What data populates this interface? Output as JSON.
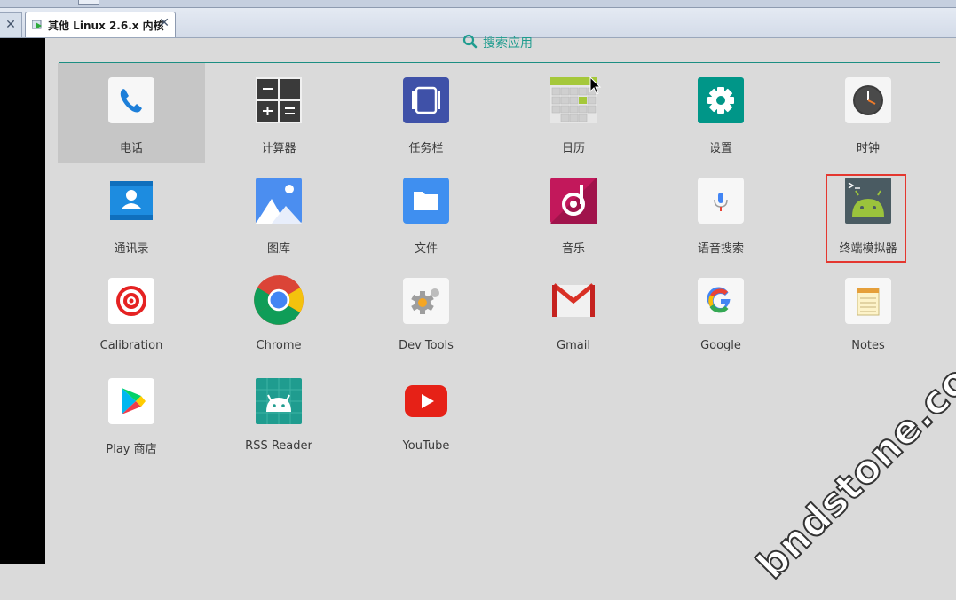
{
  "host": {
    "vm_tab_title": "其他 Linux 2.6.x 内核",
    "close_glyph": "✕"
  },
  "drawer": {
    "search_label": "搜索应用",
    "accent_color": "#1f9c8f",
    "apps": [
      {
        "label": "电话",
        "icon": "phone-icon"
      },
      {
        "label": "计算器",
        "icon": "calculator-icon"
      },
      {
        "label": "任务栏",
        "icon": "taskbar-icon"
      },
      {
        "label": "日历",
        "icon": "calendar-icon"
      },
      {
        "label": "设置",
        "icon": "gear-icon"
      },
      {
        "label": "时钟",
        "icon": "clock-icon"
      },
      {
        "label": "通讯录",
        "icon": "contacts-icon"
      },
      {
        "label": "图库",
        "icon": "gallery-icon"
      },
      {
        "label": "文件",
        "icon": "folder-icon"
      },
      {
        "label": "音乐",
        "icon": "music-icon"
      },
      {
        "label": "语音搜索",
        "icon": "microphone-icon"
      },
      {
        "label": "终端模拟器",
        "icon": "terminal-android-icon"
      },
      {
        "label": "Calibration",
        "icon": "target-icon"
      },
      {
        "label": "Chrome",
        "icon": "chrome-icon"
      },
      {
        "label": "Dev Tools",
        "icon": "dev-tools-gear-icon"
      },
      {
        "label": "Gmail",
        "icon": "gmail-icon"
      },
      {
        "label": "Google",
        "icon": "google-icon"
      },
      {
        "label": "Notes",
        "icon": "notes-icon"
      },
      {
        "label": "Play 商店",
        "icon": "play-store-icon"
      },
      {
        "label": "RSS Reader",
        "icon": "rss-android-icon"
      },
      {
        "label": "YouTube",
        "icon": "youtube-icon"
      }
    ]
  },
  "watermark": {
    "text": "bndstone.com"
  }
}
